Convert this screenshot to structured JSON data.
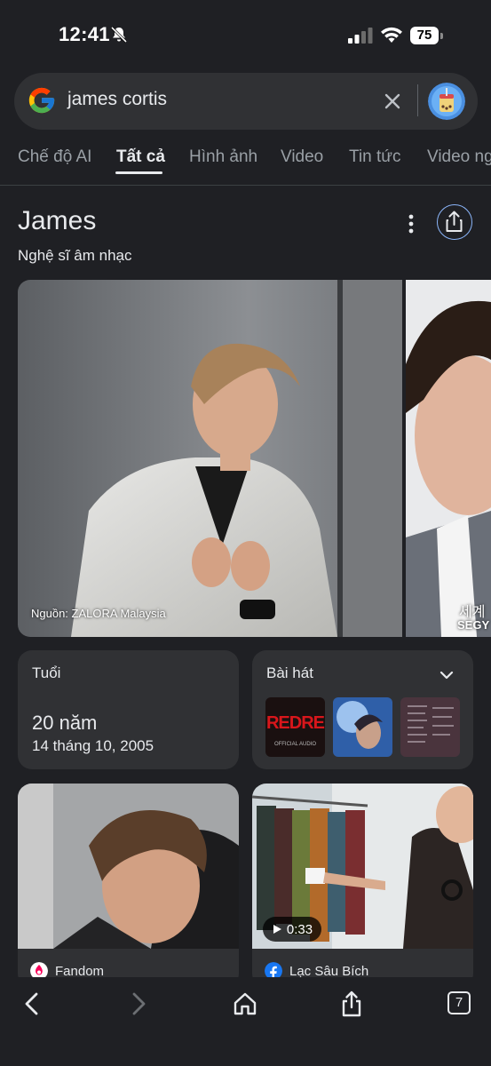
{
  "status_bar": {
    "time": "12:41",
    "battery": "75"
  },
  "search": {
    "query": "james cortis"
  },
  "tabs": [
    {
      "label": "Chế độ AI"
    },
    {
      "label": "Tất cả"
    },
    {
      "label": "Hình ảnh"
    },
    {
      "label": "Video"
    },
    {
      "label": "Tin tức"
    },
    {
      "label": "Video ng"
    }
  ],
  "entity": {
    "title": "James",
    "subtitle": "Nghệ sĩ âm nhạc",
    "photo_source": "Nguồn: ZALORA Malaysia",
    "side_watermark_1": "세계",
    "side_watermark_2": "SEGY"
  },
  "age_card": {
    "label": "Tuổi",
    "value": "20 năm",
    "date": "14 tháng 10, 2005"
  },
  "songs_card": {
    "label": "Bài hát",
    "album_1_text": "REDRE",
    "album_1_sub": "OFFICIAL AUDIO"
  },
  "results": [
    {
      "source": "Fandom"
    },
    {
      "source": "Lạc Sâu Bích",
      "duration": "0:33"
    }
  ],
  "bottom_nav": {
    "tabs_count": "7"
  },
  "colors": {
    "background": "#1f2024",
    "card": "#303134",
    "accent": "#8ab4f8"
  }
}
